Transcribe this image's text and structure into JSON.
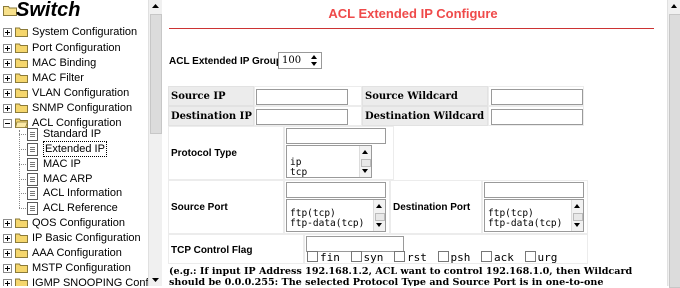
{
  "tree": {
    "title": "Switch",
    "items": [
      {
        "label": "System Configuration",
        "expander": "plus"
      },
      {
        "label": "Port Configuration",
        "expander": "plus"
      },
      {
        "label": "MAC Binding",
        "expander": "plus"
      },
      {
        "label": "MAC Filter",
        "expander": "plus"
      },
      {
        "label": "VLAN Configuration",
        "expander": "plus"
      },
      {
        "label": "SNMP Configuration",
        "expander": "plus"
      },
      {
        "label": "ACL Configuration",
        "expander": "minus"
      },
      {
        "label": "QOS Configuration",
        "expander": "plus"
      },
      {
        "label": "IP Basic Configuration",
        "expander": "plus"
      },
      {
        "label": "AAA Configuration",
        "expander": "plus"
      },
      {
        "label": "MSTP Configuration",
        "expander": "plus"
      },
      {
        "label": "IGMP SNOOPING Config",
        "expander": "plus"
      }
    ],
    "acl_children": [
      {
        "label": "Standard IP"
      },
      {
        "label": "Extended IP",
        "selected": true
      },
      {
        "label": "MAC IP"
      },
      {
        "label": "MAC ARP"
      },
      {
        "label": "ACL Information"
      },
      {
        "label": "ACL Reference"
      }
    ]
  },
  "page": {
    "title": "ACL Extended IP Configure",
    "title_color": "#ef4a4a",
    "group_num_label": "ACL Extended IP Group Num:",
    "group_num_value": "100",
    "source_ip_label": "Source IP",
    "source_wildcard_label": "Source Wildcard",
    "destination_ip_label": "Destination IP",
    "destination_wildcard_label": "Destination Wildcard",
    "protocol_type_label": "Protocol Type",
    "protocol_options": [
      "ip",
      "tcp"
    ],
    "source_port_label": "Source Port",
    "source_port_options": [
      "ftp(tcp)",
      "ftp-data(tcp)"
    ],
    "destination_port_label": "Destination Port",
    "destination_port_options": [
      "ftp(tcp)",
      "ftp-data(tcp)"
    ],
    "tcp_flag_label": "TCP Control Flag",
    "tcp_flags": [
      "fin",
      "syn",
      "rst",
      "psh",
      "ack",
      "urg"
    ],
    "note": "(e.g.: If input IP Address 192.168.1.2, ACL want to control 192.168.1.0, then Wildcard should be 0.0.0.255: The selected Protocol Type and Source Port is in one-to-one relationship. If the"
  }
}
